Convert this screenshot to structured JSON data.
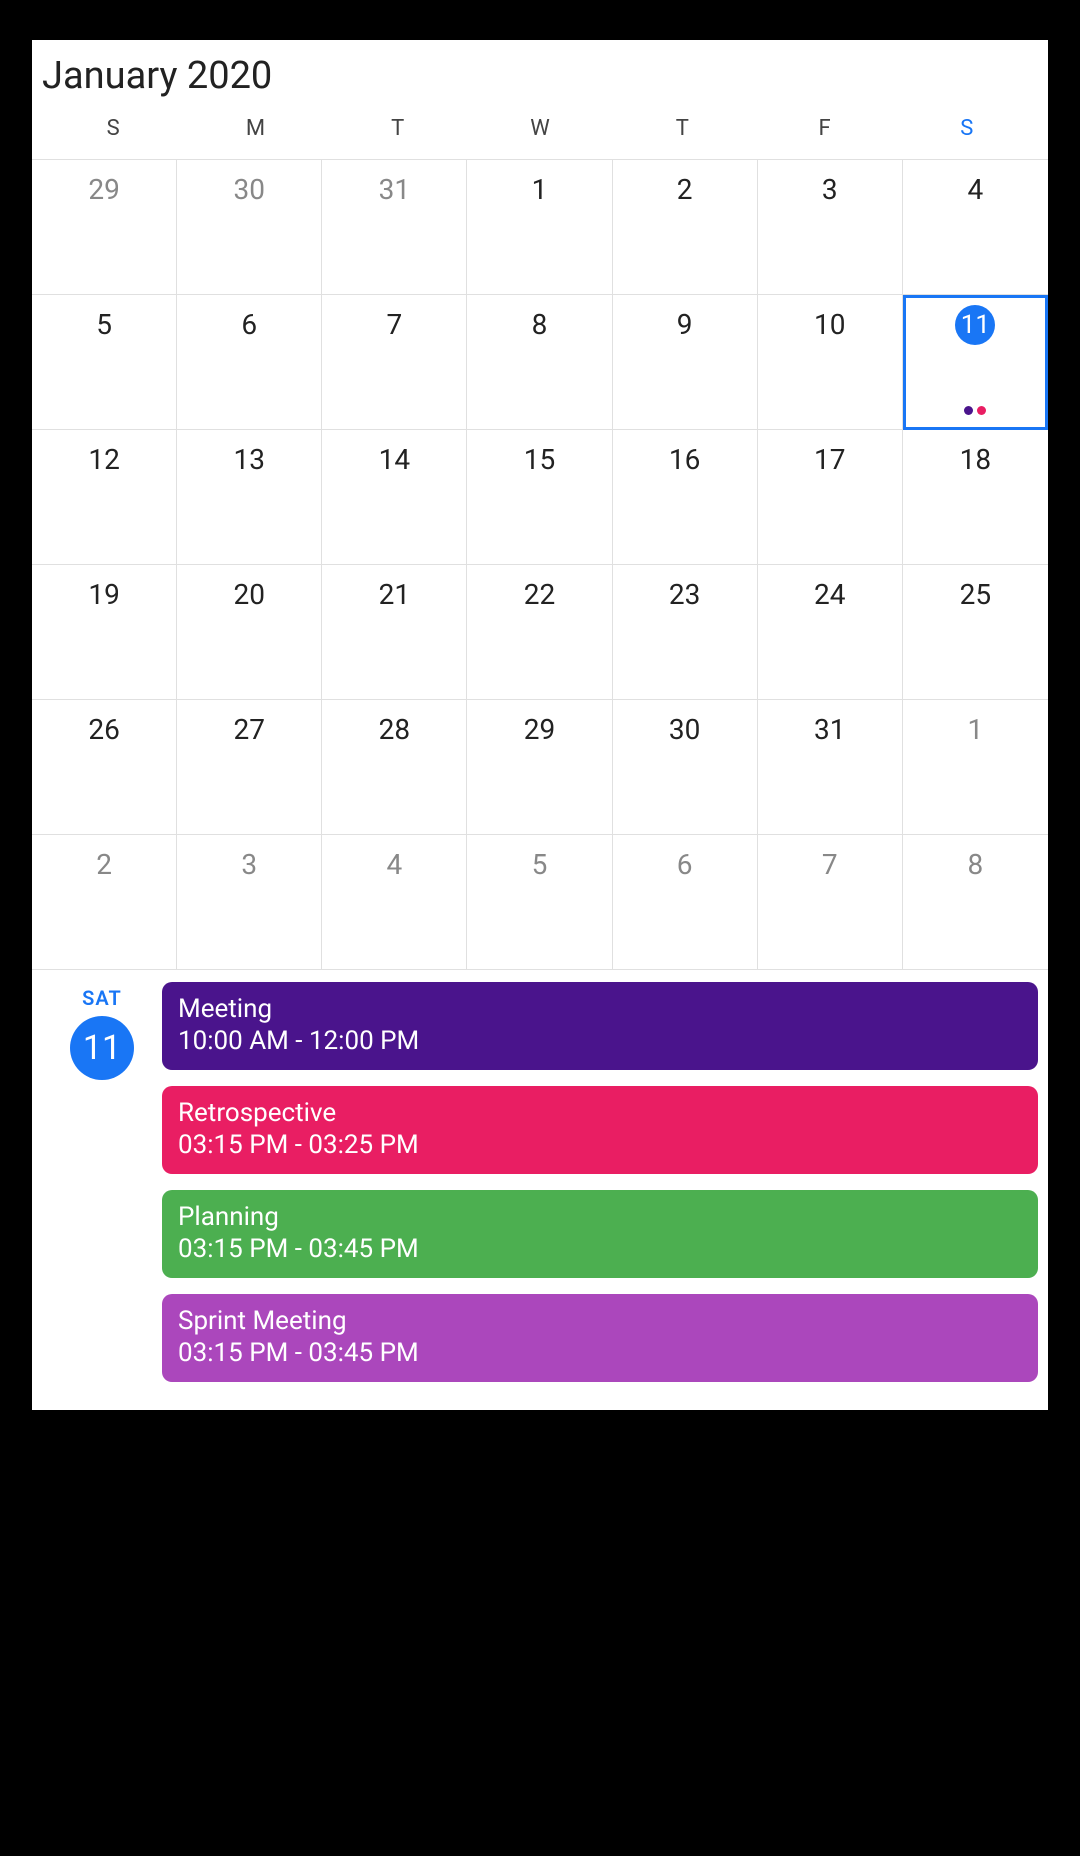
{
  "header": {
    "month_title": "January 2020"
  },
  "dow": [
    "S",
    "M",
    "T",
    "W",
    "T",
    "F",
    "S"
  ],
  "grid": [
    {
      "n": "29",
      "out": true
    },
    {
      "n": "30",
      "out": true
    },
    {
      "n": "31",
      "out": true
    },
    {
      "n": "1"
    },
    {
      "n": "2"
    },
    {
      "n": "3"
    },
    {
      "n": "4"
    },
    {
      "n": "5"
    },
    {
      "n": "6"
    },
    {
      "n": "7"
    },
    {
      "n": "8"
    },
    {
      "n": "9"
    },
    {
      "n": "10"
    },
    {
      "n": "11",
      "selected": true,
      "today": true,
      "dots": [
        "#4a148c",
        "#e91e63"
      ]
    },
    {
      "n": "12"
    },
    {
      "n": "13"
    },
    {
      "n": "14"
    },
    {
      "n": "15"
    },
    {
      "n": "16"
    },
    {
      "n": "17"
    },
    {
      "n": "18"
    },
    {
      "n": "19"
    },
    {
      "n": "20"
    },
    {
      "n": "21"
    },
    {
      "n": "22"
    },
    {
      "n": "23"
    },
    {
      "n": "24"
    },
    {
      "n": "25"
    },
    {
      "n": "26"
    },
    {
      "n": "27"
    },
    {
      "n": "28"
    },
    {
      "n": "29"
    },
    {
      "n": "30"
    },
    {
      "n": "31"
    },
    {
      "n": "1",
      "out": true
    },
    {
      "n": "2",
      "out": true
    },
    {
      "n": "3",
      "out": true
    },
    {
      "n": "4",
      "out": true
    },
    {
      "n": "5",
      "out": true
    },
    {
      "n": "6",
      "out": true
    },
    {
      "n": "7",
      "out": true
    },
    {
      "n": "8",
      "out": true
    }
  ],
  "agenda": {
    "dow": "SAT",
    "day": "11",
    "events": [
      {
        "title": "Meeting",
        "time": "10:00 AM - 12:00 PM",
        "color": "#4a148c"
      },
      {
        "title": "Retrospective",
        "time": "03:15 PM - 03:25 PM",
        "color": "#e91e63"
      },
      {
        "title": "Planning",
        "time": "03:15 PM - 03:45 PM",
        "color": "#4caf50"
      },
      {
        "title": "Sprint Meeting",
        "time": "03:15 PM - 03:45 PM",
        "color": "#ab47bc"
      }
    ]
  }
}
